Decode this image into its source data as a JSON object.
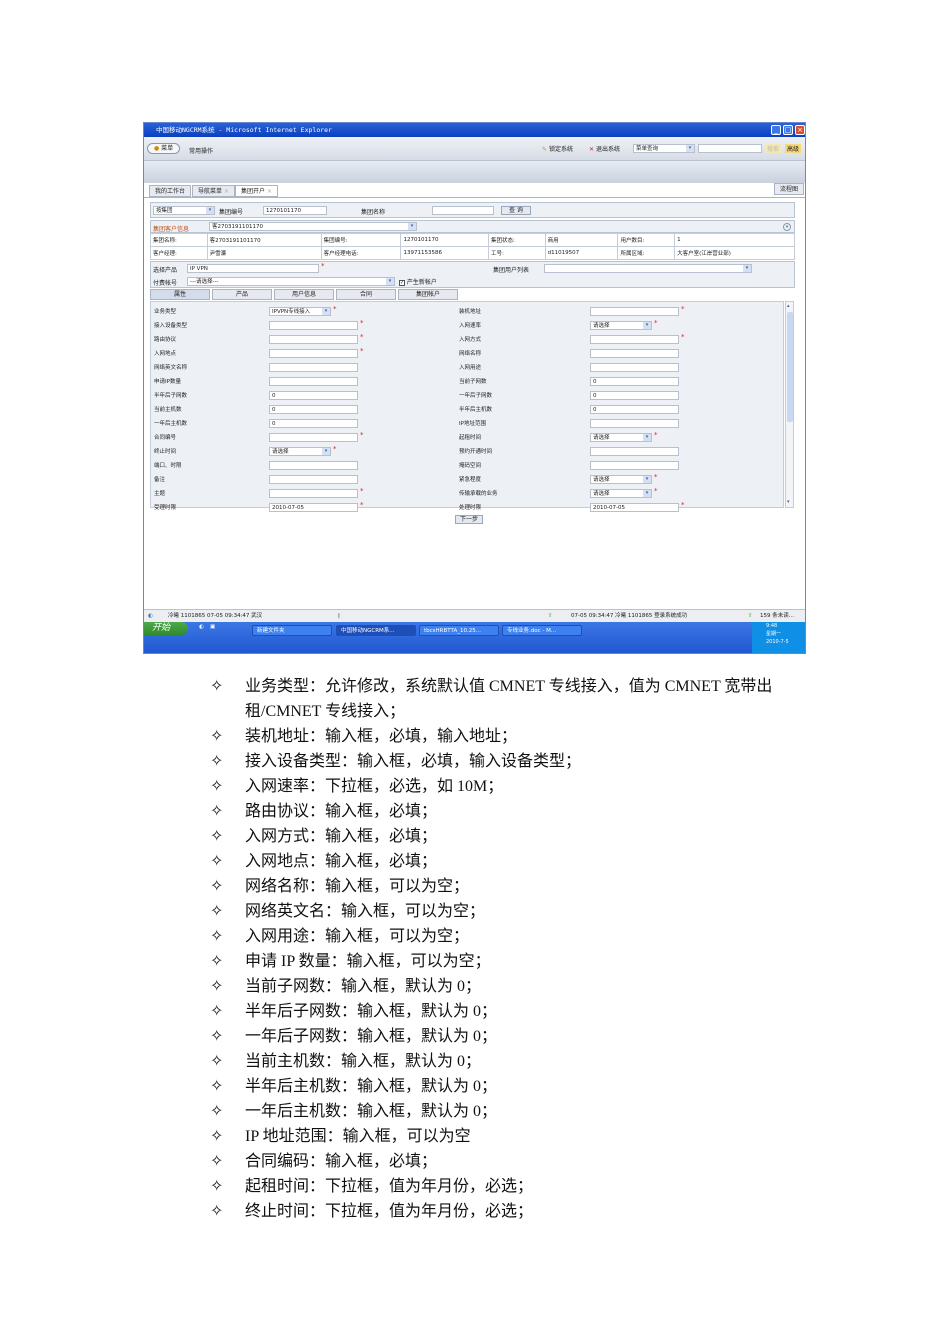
{
  "window": {
    "title": "中国移动NGCRM系统 - Microsoft Internet Explorer"
  },
  "menubar": {
    "menu_button": "菜单",
    "common_ops": "常用操作",
    "lock": "锁定系统",
    "logout": "退出系统",
    "search_select": "菜单查询",
    "search_btn": "搜索",
    "advanced_btn": "高级"
  },
  "tabs": [
    {
      "label": "我的工作台"
    },
    {
      "label": "导航菜单"
    },
    {
      "label": "集团开户"
    }
  ],
  "flowchart_btn": "流程图",
  "query": {
    "type_select": "按集团",
    "group_no_label": "集团编号",
    "group_no_value": "1270101170",
    "group_name_label": "集团名称",
    "group_name_value": "",
    "query_btn": "查 询"
  },
  "customer": {
    "label": "集团客户信息",
    "value": "客2703191101170"
  },
  "info": {
    "rows": [
      [
        "集团名称:",
        "客2703191101170",
        "集团编号:",
        "1270101170",
        "集团状态:",
        "商用",
        "用户数目:",
        "1"
      ],
      [
        "客户经理:",
        "尹雪濂",
        "客户经理电话:",
        "13971153586",
        "工号:",
        "d11019507",
        "所属区域:",
        "大客户室(江岸营业部)"
      ]
    ]
  },
  "product": {
    "label": "选择产品",
    "value": "IP VPN",
    "user_list_label": "集团用户列表",
    "pay_label": "付费帐号",
    "pay_value": "---请选择---",
    "new_account_label": "产生新帐户",
    "new_account_checked": true
  },
  "subtabs": [
    "属性",
    "产品",
    "用户信息",
    "合同",
    "集团帐户"
  ],
  "form": {
    "left": [
      {
        "label": "业务类型",
        "type": "select",
        "value": "IPVPN专线接入",
        "required": true
      },
      {
        "label": "接入设备类型",
        "type": "input",
        "value": "",
        "required": true
      },
      {
        "label": "路由协议",
        "type": "input",
        "value": "",
        "required": true
      },
      {
        "label": "入网地点",
        "type": "input",
        "value": "",
        "required": true
      },
      {
        "label": "网络英文名称",
        "type": "input",
        "value": "",
        "required": false
      },
      {
        "label": "申请IP数量",
        "type": "input",
        "value": "",
        "required": false
      },
      {
        "label": "半年后子网数",
        "type": "input",
        "value": "0",
        "required": false
      },
      {
        "label": "当前主机数",
        "type": "input",
        "value": "0",
        "required": false
      },
      {
        "label": "一年后主机数",
        "type": "input",
        "value": "0",
        "required": false
      },
      {
        "label": "合同编号",
        "type": "input",
        "value": "",
        "required": true
      },
      {
        "label": "终止时间",
        "type": "select",
        "value": "请选择",
        "required": true
      },
      {
        "label": "端口、时限",
        "type": "input",
        "value": "",
        "required": false
      },
      {
        "label": "备注",
        "type": "input",
        "value": "",
        "required": false
      },
      {
        "label": "主题",
        "type": "input",
        "value": "",
        "required": true
      },
      {
        "label": "受理时限",
        "type": "input",
        "value": "2010-07-05",
        "required": true
      }
    ],
    "right": [
      {
        "label": "装机地址",
        "type": "input",
        "value": "",
        "required": true
      },
      {
        "label": "入网速率",
        "type": "select",
        "value": "请选择",
        "required": true
      },
      {
        "label": "入网方式",
        "type": "input",
        "value": "",
        "required": true
      },
      {
        "label": "网络名称",
        "type": "input",
        "value": "",
        "required": false
      },
      {
        "label": "入网用途",
        "type": "input",
        "value": "",
        "required": false
      },
      {
        "label": "当前子网数",
        "type": "input",
        "value": "0",
        "required": false
      },
      {
        "label": "一年后子网数",
        "type": "input",
        "value": "0",
        "required": false
      },
      {
        "label": "半年后主机数",
        "type": "input",
        "value": "0",
        "required": false
      },
      {
        "label": "IP地址范围",
        "type": "input",
        "value": "",
        "required": false
      },
      {
        "label": "起租时间",
        "type": "select",
        "value": "请选择",
        "required": true
      },
      {
        "label": "预约开通时间",
        "type": "input",
        "value": "",
        "required": false
      },
      {
        "label": "掩码空间",
        "type": "input",
        "value": "",
        "required": false
      },
      {
        "label": "紧急程度",
        "type": "select",
        "value": "请选择",
        "required": true
      },
      {
        "label": "传输承载的业务",
        "type": "select",
        "value": "请选择",
        "required": true
      },
      {
        "label": "处理时限",
        "type": "input",
        "value": "2010-07-05",
        "required": true
      }
    ],
    "next_btn": "下一步"
  },
  "status": {
    "left": "冷曦 1101865  07-05 09:34:47 武汉",
    "sep": "|",
    "center": "07-05 09:34:47  冷曦 1101865 登录系统成功",
    "right": "159 条未读..."
  },
  "taskbar": {
    "start": "开始",
    "tasks": [
      "新建文件夹",
      "中国移动NGCRM系...",
      "tbcsHRBTTA_10.25...",
      "专线业务.doc - M..."
    ],
    "time": "9:48",
    "weekday": "星期一",
    "date": "2010-7-5"
  },
  "bullets": [
    {
      "mark": "✧",
      "text": "业务类型：允许修改，系统默认值 CMNET 专线接入，值为 CMNET 宽带出租/CMNET 专线接入；"
    },
    {
      "mark": "✧",
      "text": "装机地址：输入框，必填，输入地址；"
    },
    {
      "mark": "✧",
      "text": "接入设备类型：输入框，必填，输入设备类型；"
    },
    {
      "mark": "✧",
      "text": "入网速率：下拉框，必选，如 10M；"
    },
    {
      "mark": "✧",
      "text": "路由协议：输入框，必填；"
    },
    {
      "mark": "✧",
      "text": "入网方式：输入框，必填；"
    },
    {
      "mark": "✧",
      "text": "入网地点：输入框，必填；"
    },
    {
      "mark": "✧",
      "text": "网络名称：输入框，可以为空；"
    },
    {
      "mark": "✧",
      "text": "网络英文名：输入框，可以为空；"
    },
    {
      "mark": "✧",
      "text": "入网用途：输入框，可以为空；"
    },
    {
      "mark": "✧",
      "text": "申请 IP 数量：输入框，可以为空；"
    },
    {
      "mark": "✧",
      "text": "当前子网数：输入框，默认为 0；"
    },
    {
      "mark": "✧",
      "text": "半年后子网数：输入框，默认为 0；"
    },
    {
      "mark": "✧",
      "text": "一年后子网数：输入框，默认为 0；"
    },
    {
      "mark": "✧",
      "text": "当前主机数：输入框，默认为 0；"
    },
    {
      "mark": "✧",
      "text": "半年后主机数：输入框，默认为 0；"
    },
    {
      "mark": "✧",
      "text": "一年后主机数：输入框，默认为 0；"
    },
    {
      "mark": "✧",
      "text": "IP 地址范围：输入框，可以为空"
    },
    {
      "mark": "✧",
      "text": "合同编码：输入框，必填；"
    },
    {
      "mark": "✧",
      "text": "起租时间：下拉框，值为年月份，必选；"
    },
    {
      "mark": "✧",
      "text": "终止时间：下拉框，值为年月份，必选；"
    }
  ]
}
